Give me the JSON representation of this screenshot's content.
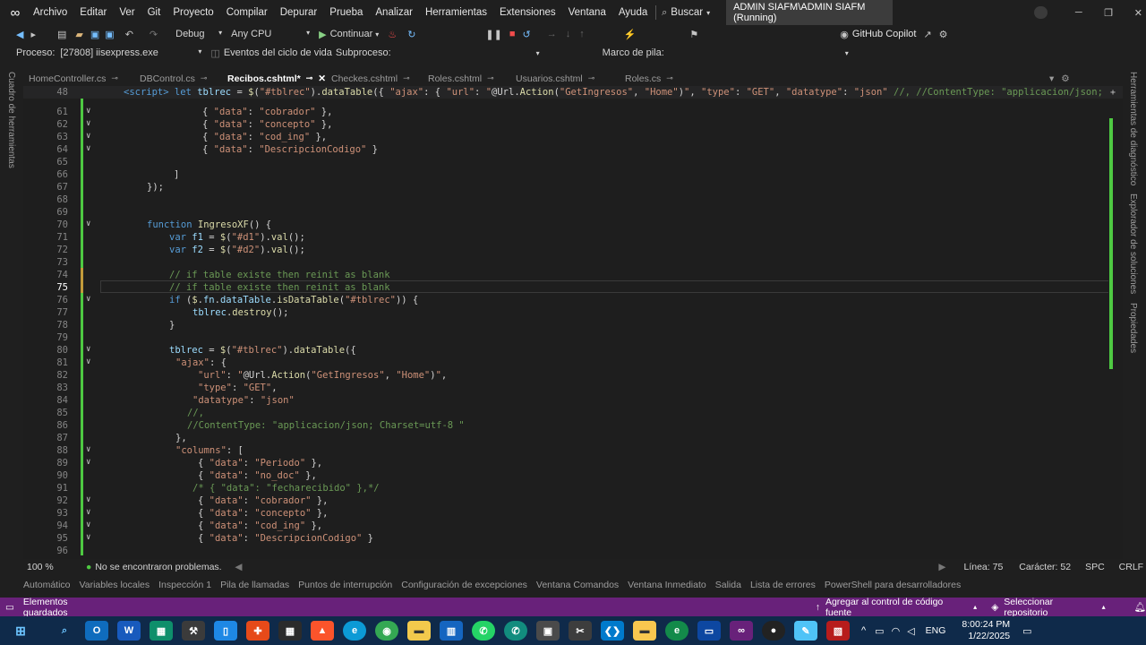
{
  "menu": {
    "items": [
      "Archivo",
      "Editar",
      "Ver",
      "Git",
      "Proyecto",
      "Compilar",
      "Depurar",
      "Prueba",
      "Analizar",
      "Herramientas",
      "Extensiones",
      "Ventana",
      "Ayuda"
    ],
    "search": "Buscar",
    "session": "ADMIN SIAFM\\ADMIN SIAFM (Running)"
  },
  "toolbar": {
    "config": "Debug",
    "platform": "Any CPU",
    "continue": "Continuar",
    "copilot": "GitHub Copilot"
  },
  "procbar": {
    "proceso_label": "Proceso:",
    "proceso_value": "[27808] iisexpress.exe",
    "eventos": "Eventos del ciclo de vida",
    "subproceso": "Subproceso:",
    "marco": "Marco de pila:"
  },
  "tabs": [
    "HomeController.cs",
    "DBControl.cs",
    "Recibos.cshtml*",
    "Checkes.cshtml",
    "Roles.cshtml",
    "Usuarios.cshtml",
    "Roles.cs"
  ],
  "lines": [
    {
      "n": "48",
      "html": "<span class='tag'>&lt;script&gt;</span> <span class='kw'>let</span> <span class='var'>tblrec</span> = <span class='fn'>$</span>(<span class='str'>\"#tblrec\"</span>).<span class='fn'>dataTable</span>({ <span class='str'>\"ajax\"</span>: { <span class='str'>\"url\"</span>: <span class='str'>\"</span>@Url.<span class='fn'>Action</span>(<span class='str'>\"GetIngresos\"</span>, <span class='str'>\"Home\"</span>)<span class='str'>\"</span>, <span class='str'>\"type\"</span>: <span class='str'>\"GET\"</span>, <span class='str'>\"datatype\"</span>: <span class='str'>\"json\"</span> <span class='cm'>//, //ContentType: \"applicacion/json;</span>",
      "ind": 0
    },
    {
      "n": "61",
      "html": "{ <span class='str'>\"data\"</span>: <span class='str'>\"cobrador\"</span> },",
      "ind": 88
    },
    {
      "n": "62",
      "html": "{ <span class='str'>\"data\"</span>: <span class='str'>\"concepto\"</span> },",
      "ind": 88
    },
    {
      "n": "63",
      "html": "{ <span class='str'>\"data\"</span>: <span class='str'>\"cod_ing\"</span> },",
      "ind": 88
    },
    {
      "n": "64",
      "html": "{ <span class='str'>\"data\"</span>: <span class='str'>\"DescripcionCodigo\"</span> }",
      "ind": 88
    },
    {
      "n": "65",
      "html": "",
      "ind": 0
    },
    {
      "n": "66",
      "html": "]",
      "ind": 56
    },
    {
      "n": "67",
      "html": "});",
      "ind": 26
    },
    {
      "n": "68",
      "html": "",
      "ind": 0
    },
    {
      "n": "69",
      "html": "",
      "ind": 0
    },
    {
      "n": "70",
      "html": "<span class='kw'>function</span> <span class='fn'>IngresoXF</span>() {",
      "ind": 26
    },
    {
      "n": "71",
      "html": "<span class='kw'>var</span> <span class='var'>f1</span> = <span class='fn'>$</span>(<span class='str'>\"#d1\"</span>).<span class='fn'>val</span>();",
      "ind": 51
    },
    {
      "n": "72",
      "html": "<span class='kw'>var</span> <span class='var'>f2</span> = <span class='fn'>$</span>(<span class='str'>\"#d2\"</span>).<span class='fn'>val</span>();",
      "ind": 51
    },
    {
      "n": "73",
      "html": "",
      "ind": 0
    },
    {
      "n": "74",
      "html": "<span class='cm'>// if table existe then reinit as blank</span>",
      "ind": 51
    },
    {
      "n": "75",
      "html": "<span class='cm'>// if table existe then reinit as blank</span>",
      "ind": 51
    },
    {
      "n": "76",
      "html": "<span class='kw'>if</span> (<span class='fn'>$</span>.<span class='var'>fn</span>.<span class='var'>dataTable</span>.<span class='fn'>isDataTable</span>(<span class='str'>\"#tblrec\"</span>)) {",
      "ind": 51
    },
    {
      "n": "77",
      "html": "<span class='var'>tblrec</span>.<span class='fn'>destroy</span>();",
      "ind": 77
    },
    {
      "n": "78",
      "html": "}",
      "ind": 51
    },
    {
      "n": "79",
      "html": "",
      "ind": 0
    },
    {
      "n": "80",
      "html": "<span class='var'>tblrec</span> = <span class='fn'>$</span>(<span class='str'>\"#tblrec\"</span>).<span class='fn'>dataTable</span>({",
      "ind": 51
    },
    {
      "n": "81",
      "html": "<span class='str'>\"ajax\"</span>: {",
      "ind": 58
    },
    {
      "n": "82",
      "html": "<span class='str'>\"url\"</span>: <span class='str'>\"</span>@Url.<span class='fn'>Action</span>(<span class='str'>\"GetIngresos\"</span>, <span class='str'>\"Home\"</span>)<span class='str'>\"</span>,",
      "ind": 83
    },
    {
      "n": "83",
      "html": "<span class='str'>\"type\"</span>: <span class='str'>\"GET\"</span>,",
      "ind": 83
    },
    {
      "n": "84",
      "html": "<span class='str'>\"datatype\"</span>: <span class='str'>\"json\"</span>",
      "ind": 77
    },
    {
      "n": "85",
      "html": "<span class='cm'>//,</span>",
      "ind": 71
    },
    {
      "n": "86",
      "html": "<span class='cm'>//ContentType: \"applicacion/json; Charset=utf-8 \"</span>",
      "ind": 71
    },
    {
      "n": "87",
      "html": "},",
      "ind": 58
    },
    {
      "n": "88",
      "html": "<span class='str'>\"columns\"</span>: [",
      "ind": 58
    },
    {
      "n": "89",
      "html": "{ <span class='str'>\"data\"</span>: <span class='str'>\"Periodo\"</span> },",
      "ind": 83
    },
    {
      "n": "90",
      "html": "{ <span class='str'>\"data\"</span>: <span class='str'>\"no_doc\"</span> },",
      "ind": 83
    },
    {
      "n": "91",
      "html": "<span class='cm'>/* { \"data\": \"fecharecibido\" },*/</span>",
      "ind": 77
    },
    {
      "n": "92",
      "html": "{ <span class='str'>\"data\"</span>: <span class='str'>\"cobrador\"</span> },",
      "ind": 83
    },
    {
      "n": "93",
      "html": "{ <span class='str'>\"data\"</span>: <span class='str'>\"concepto\"</span> },",
      "ind": 83
    },
    {
      "n": "94",
      "html": "{ <span class='str'>\"data\"</span>: <span class='str'>\"cod_ing\"</span> },",
      "ind": 83
    },
    {
      "n": "95",
      "html": "{ <span class='str'>\"data\"</span>: <span class='str'>\"DescripcionCodigo\"</span> }",
      "ind": 83
    },
    {
      "n": "96",
      "html": "",
      "ind": 0
    }
  ],
  "status": {
    "zoom": "100 %",
    "problems": "No se encontraron problemas.",
    "line": "Línea: 75",
    "char": "Carácter: 52",
    "spc": "SPC",
    "crlf": "CRLF"
  },
  "panels": [
    "Automático",
    "Variables locales",
    "Inspección 1",
    "Pila de llamadas",
    "Puntos de interrupción",
    "Configuración de excepciones",
    "Ventana Comandos",
    "Ventana Inmediato",
    "Salida",
    "Lista de errores",
    "PowerShell para desarrolladores"
  ],
  "vsstatus": {
    "left": "Elementos guardados",
    "source": "Agregar al control de código fuente",
    "repo": "Seleccionar repositorio"
  },
  "side": {
    "left": "Cuadro de herramientas",
    "right1": "Herramientas de diagnóstico",
    "right2": "Explorador de soluciones",
    "right3": "Propiedades"
  },
  "taskbar": {
    "lang": "ENG",
    "time": "8:00:24 PM",
    "date": "1/22/2025"
  }
}
